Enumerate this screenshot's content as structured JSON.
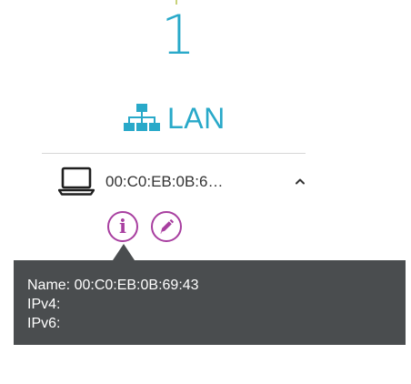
{
  "summary": {
    "count": "1",
    "network_label": "LAN",
    "network_icon": "network-topology-icon",
    "accent_color": "#29a9c9"
  },
  "device": {
    "icon": "laptop-icon",
    "name_truncated": "00:C0:EB:0B:6…",
    "expanded": true,
    "chevron_icon": "chevron-up-icon"
  },
  "actions": {
    "info_icon": "info-icon",
    "edit_icon": "pencil-icon",
    "color": "#a83fa0"
  },
  "tooltip": {
    "name_line": "Name: 00:C0:EB:0B:69:43",
    "ipv4_line": "IPv4:",
    "ipv6_line": "IPv6:",
    "background": "#4a4d4f"
  }
}
